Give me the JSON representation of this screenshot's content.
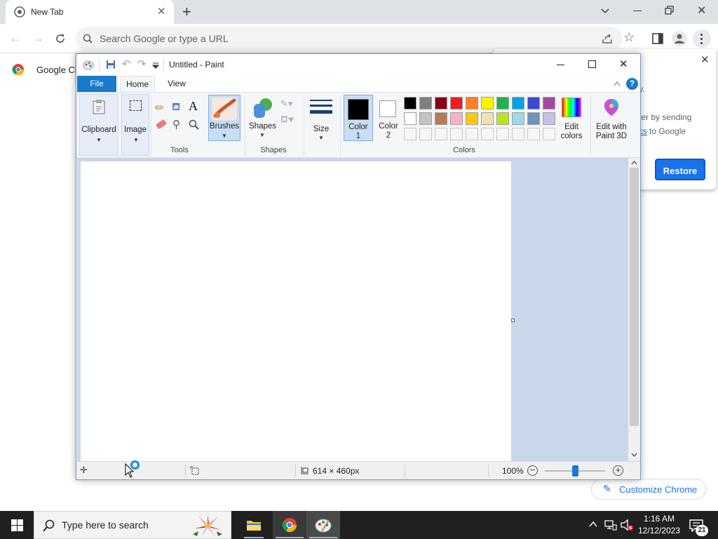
{
  "chrome": {
    "tab_title": "New Tab",
    "omnibox_placeholder": "Search Google or type a URL",
    "bookmark_label": "Google Ch",
    "popup": {
      "text_line1": "y.",
      "text_line2": "ter by sending",
      "text_line3_link": "cs",
      "text_line3_rest": "to Google",
      "restore_label": "Restore"
    },
    "customize_label": "Customize Chrome"
  },
  "paint": {
    "title": "Untitled - Paint",
    "tabs": [
      "File",
      "Home",
      "View"
    ],
    "groups": {
      "clipboard_label": "Clipboard",
      "image_label": "Image",
      "tools_label": "Tools",
      "brushes_label": "Brushes",
      "shapes_btn_label": "Shapes",
      "shapes_group_label": "Shapes",
      "size_label": "Size",
      "color1_label": "Color\n1",
      "color1_line1": "Color",
      "color1_line2": "1",
      "color2_line1": "Color",
      "color2_line2": "2",
      "colors_group_label": "Colors",
      "edit_colors_line1": "Edit",
      "edit_colors_line2": "colors",
      "edit3d_line1": "Edit with",
      "edit3d_line2": "Paint 3D"
    },
    "palette_row1": [
      "#000000",
      "#7f7f7f",
      "#880015",
      "#ed1c24",
      "#ff7f27",
      "#fff200",
      "#22b14c",
      "#00a2e8",
      "#3f48cc",
      "#a349a4"
    ],
    "palette_row2": [
      "#ffffff",
      "#c3c3c3",
      "#b97a57",
      "#ffaec9",
      "#ffc90e",
      "#efe4b0",
      "#b5e61d",
      "#99d9ea",
      "#7092be",
      "#c8bfe7"
    ],
    "status": {
      "canvas_size": "614 × 460px",
      "zoom": "100%"
    }
  },
  "taskbar": {
    "search_placeholder": "Type here to search",
    "time": "1:16 AM",
    "date": "12/12/2023",
    "notification_count": "21"
  }
}
